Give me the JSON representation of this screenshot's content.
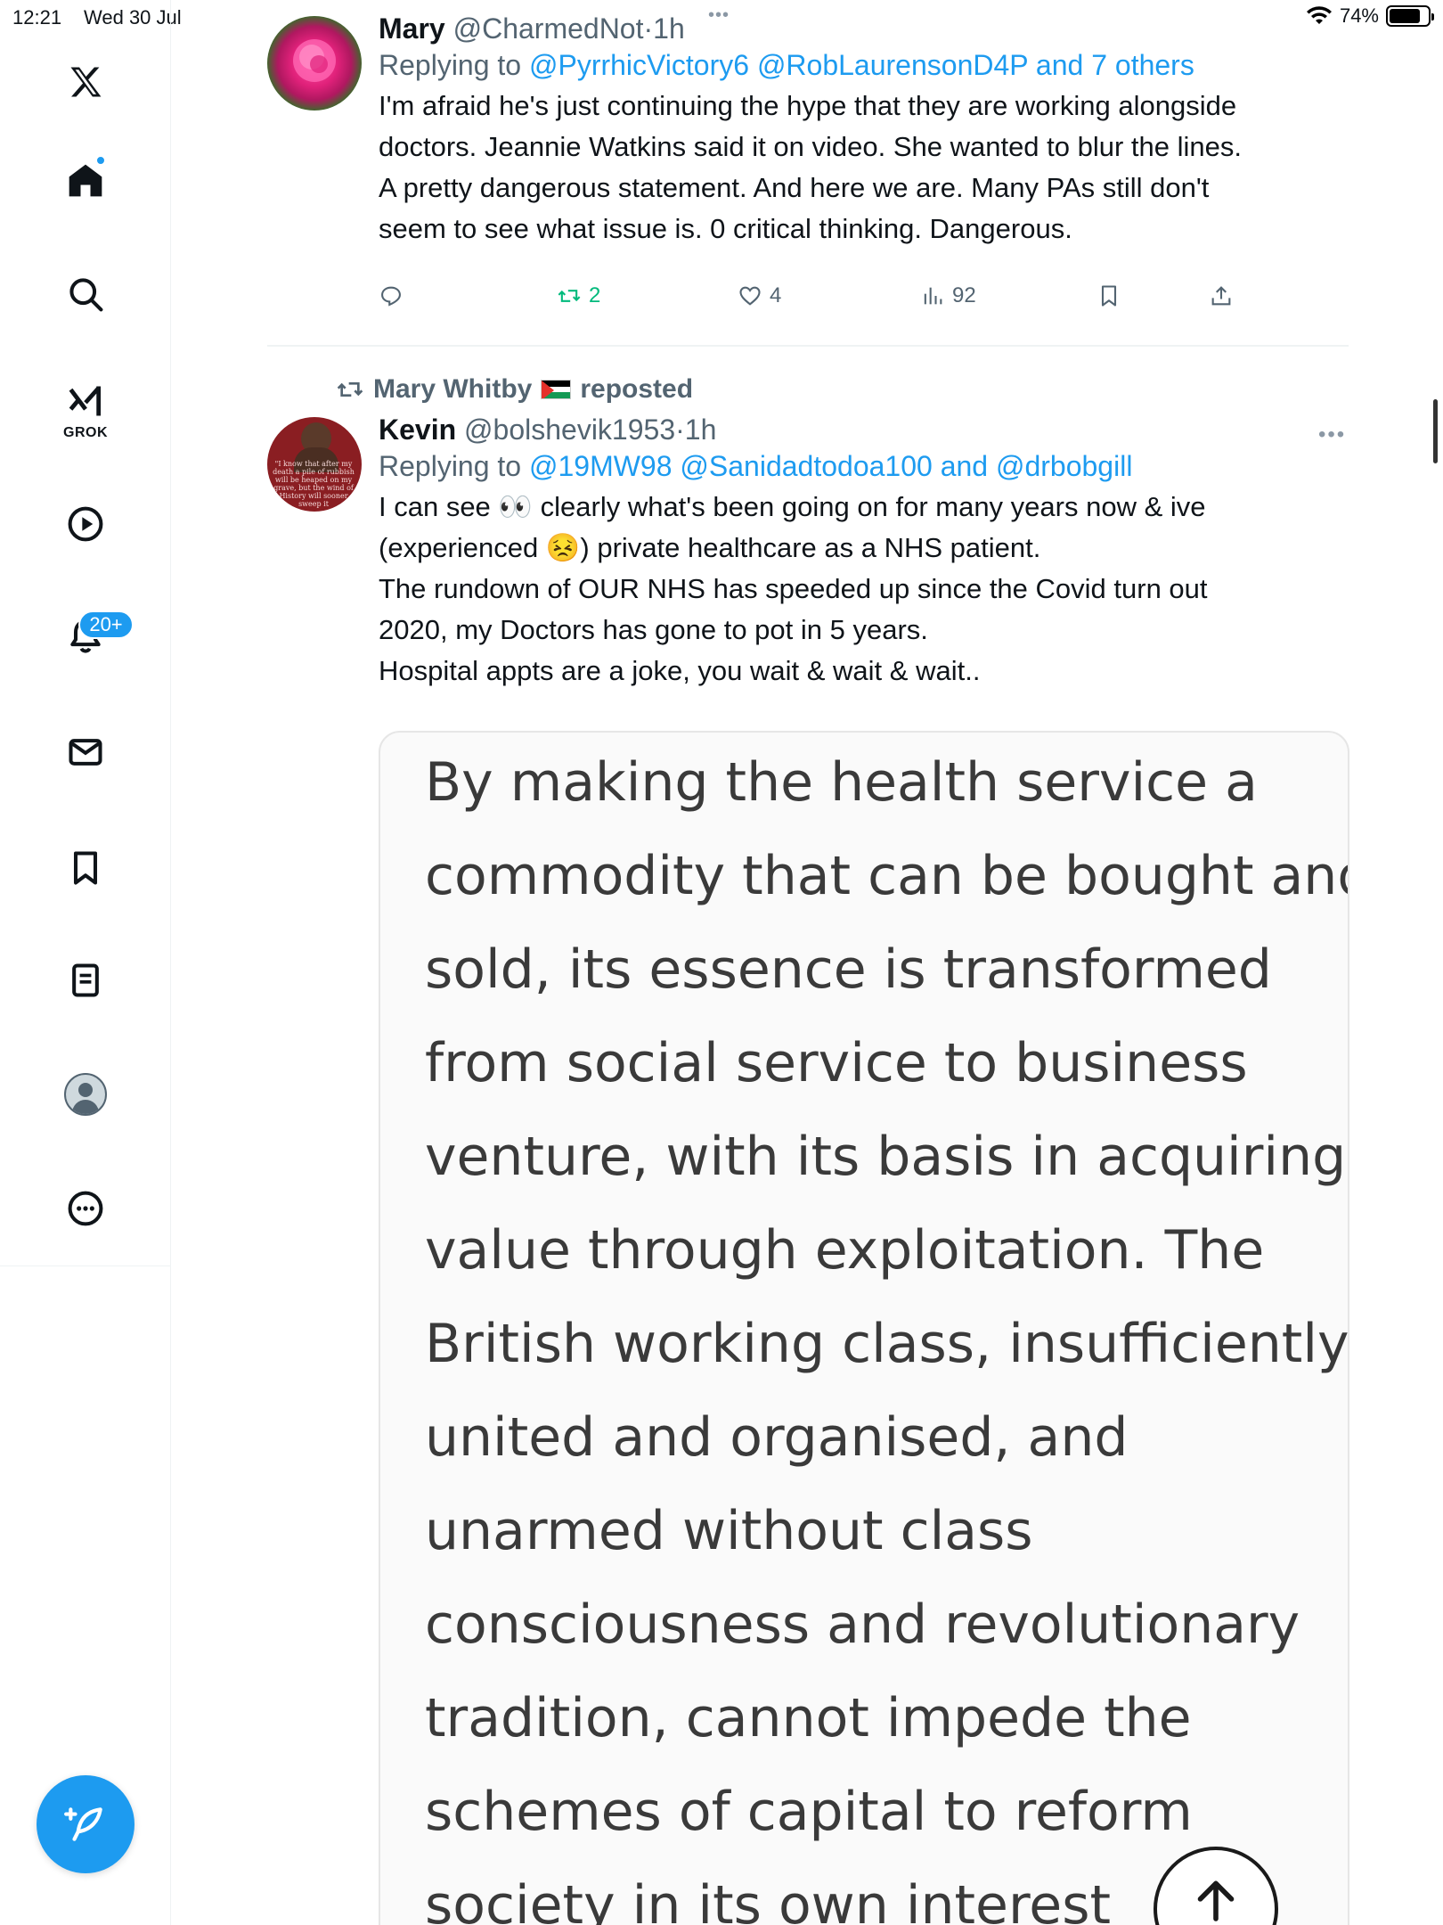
{
  "status_bar": {
    "time": "12:21",
    "date": "Wed 30 Jul",
    "battery": "74%",
    "battery_level": 0.74
  },
  "sidebar": {
    "items": [
      {
        "icon": "x-logo-icon"
      },
      {
        "icon": "home-icon"
      },
      {
        "icon": "search-icon"
      },
      {
        "icon": "grok-icon",
        "label": "GROK"
      },
      {
        "icon": "video-play-icon"
      },
      {
        "icon": "notifications-bell-icon",
        "badge": "20+"
      },
      {
        "icon": "messages-mail-icon"
      },
      {
        "icon": "bookmark-icon"
      },
      {
        "icon": "lists-icon"
      },
      {
        "icon": "profile-avatar-icon"
      },
      {
        "icon": "more-circle-icon"
      }
    ],
    "compose_icon": "compose-feather-plus-icon"
  },
  "tweet1": {
    "name": "Mary",
    "handle": "@CharmedNot",
    "dot": "·",
    "time": "1h",
    "replying_prefix": "Replying to ",
    "replying_mentions": "@PyrrhicVictory6 @RobLaurensonD4P and 7 others",
    "text_lines": [
      "I'm afraid he's just continuing the hype that they are working alongside",
      "doctors.  Jeannie Watkins said it on video.  She wanted to blur the lines.",
      "A pretty dangerous statement.   And here we are.  Many PAs still don't",
      "seem to see what issue is.  0 critical thinking.  Dangerous."
    ],
    "reply_count": "",
    "retweet_count": "2",
    "like_count": "4",
    "view_count": "92"
  },
  "tweet2": {
    "repost_by": "Mary Whitby",
    "repost_label": "reposted",
    "name": "Kevin",
    "handle": "@bolshevik1953",
    "dot": "·",
    "time": "1h",
    "replying_prefix": "Replying to ",
    "replying_mentions": "@19MW98 @Sanidadtodoa100 and @drbobgill",
    "text_lines": [
      "I can see 👀 clearly what's been going on for many years now & ive",
      "(experienced 😣) private healthcare as a NHS patient.",
      "The rundown of OUR NHS has speeded up since the Covid turn out",
      "2020, my Doctors has gone to pot in 5 years.",
      "Hospital appts are a joke, you wait & wait & wait.."
    ],
    "avatar_text": "\"I know that after my death a pile of rubbish will be heaped on my grave, but the wind of History will sooner sweep it",
    "image_text_lines": [
      "By making the health service a",
      "commodity that can be bought and",
      "sold, its essence is transformed",
      "from social service to business",
      "venture, with its basis in acquiring",
      "value through exploitation. The",
      "British working class, insufficiently",
      "united and organised, and",
      "unarmed without class",
      "consciousness and revolutionary",
      "tradition, cannot impede the",
      "schemes of capital to reform",
      "society in its own interest"
    ]
  },
  "colors": {
    "accent": "#1d9bf0",
    "retweet_green": "#00ba7c",
    "muted": "#536471",
    "text": "#0f1419"
  }
}
